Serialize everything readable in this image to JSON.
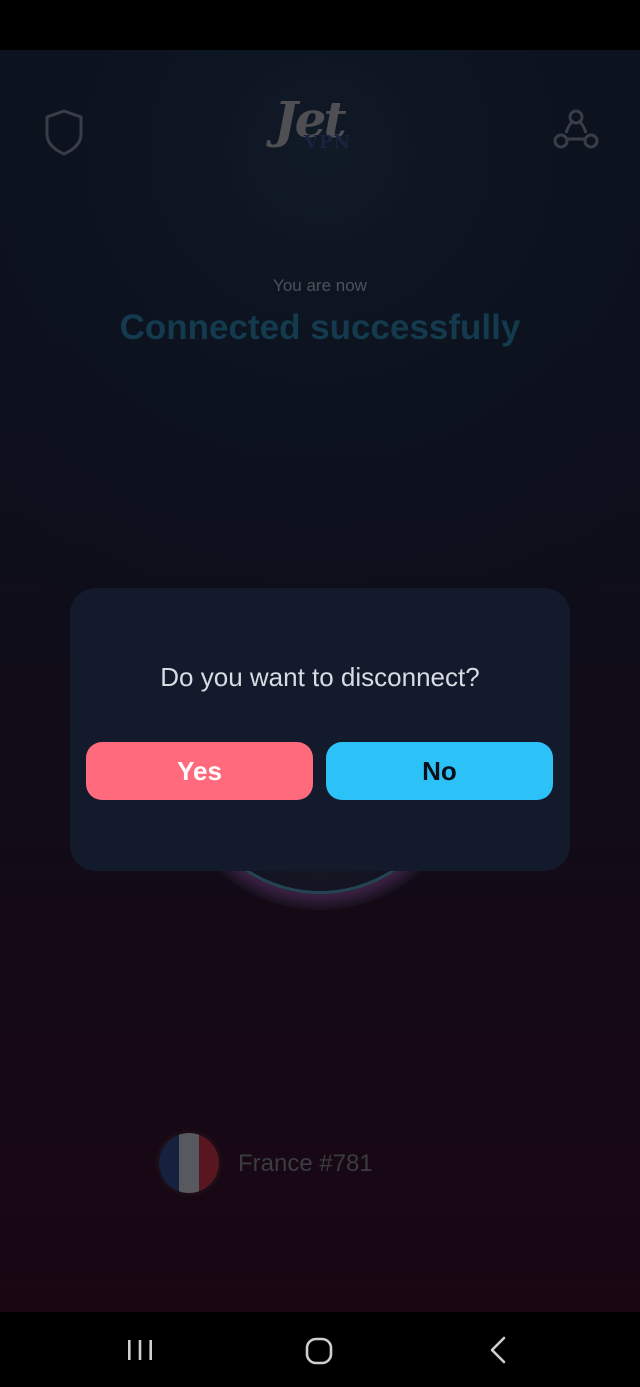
{
  "app": {
    "logo": {
      "primary": "Jet",
      "secondary": "VPN"
    },
    "status": {
      "subtitle": "You are now",
      "headline": "Connected successfully"
    },
    "location": {
      "country": "France",
      "server": "France #781"
    }
  },
  "dialog": {
    "message": "Do you want to disconnect?",
    "confirm_label": "Yes",
    "cancel_label": "No"
  },
  "icons": {
    "shield": "shield-icon",
    "share": "share-icon",
    "recent": "recent-apps-icon",
    "home": "home-icon",
    "back": "back-icon"
  },
  "colors": {
    "accent_connected": "#1f5f7d",
    "yes_button": "#ff6b7d",
    "no_button": "#2dc2f7",
    "dialog_bg": "#121a2c"
  }
}
